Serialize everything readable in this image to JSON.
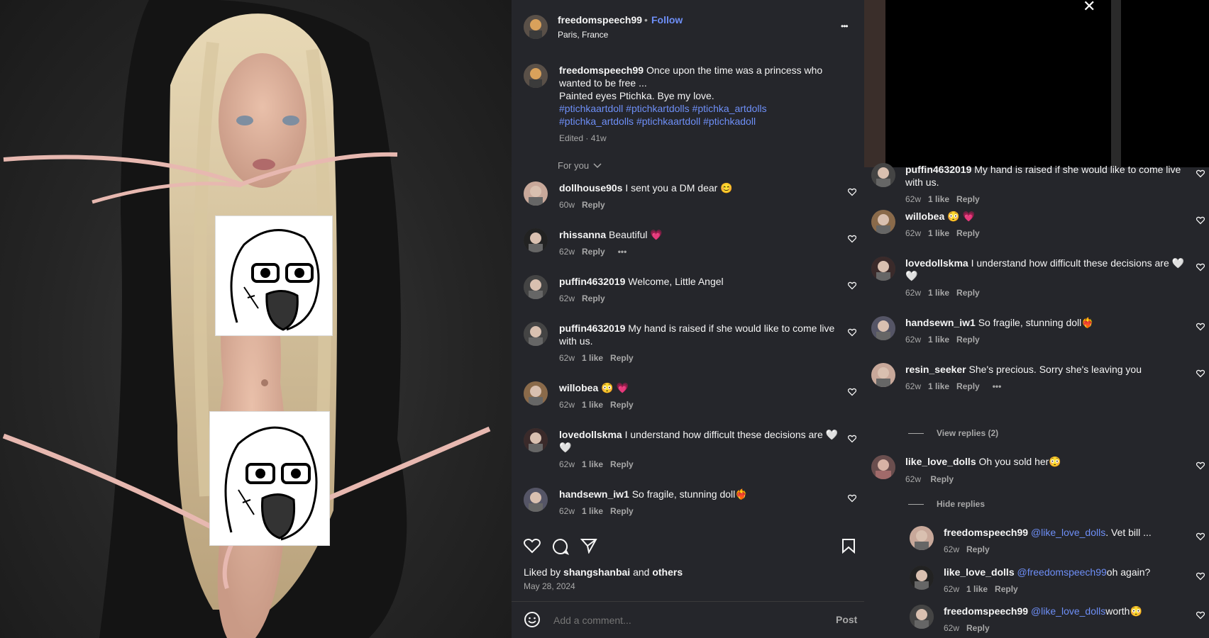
{
  "post": {
    "author": "freedomspeech99",
    "separator": "•",
    "follow_label": "Follow",
    "location": "Paris, France",
    "more_label": "•••",
    "caption_line1": "Once upon the time was a princess who",
    "caption_line2": "wanted to be free ...",
    "caption_line3": "Painted eyes Ptichka. Bye my love.",
    "hashtags_line1": "#ptichkaartdoll #ptichkartdolls #ptichka_artdolls",
    "hashtags_line2": "#ptichka_artdolls #ptichkaartdoll #ptichkadoll",
    "edited_meta": "Edited · 41w",
    "for_you_label": "For you",
    "liked_by_prefix": "Liked by",
    "liked_by_user": "shangshanbai",
    "liked_by_and": "and",
    "liked_by_others": "others",
    "date": "May 28, 2024",
    "add_comment_placeholder": "Add a comment...",
    "post_label": "Post",
    "close_label": "✕"
  },
  "comments_main": [
    {
      "user": "dollhouse90s",
      "text": "I sent you a DM dear 😊",
      "text2": "",
      "time": "60w",
      "likes": "",
      "reply": "Reply",
      "more": ""
    },
    {
      "user": "rhissanna",
      "text": "Beautiful 💗",
      "text2": "",
      "time": "62w",
      "likes": "",
      "reply": "Reply",
      "more": "•••"
    },
    {
      "user": "puffin4632019",
      "text": "Welcome, Little Angel",
      "text2": "",
      "time": "62w",
      "likes": "",
      "reply": "Reply",
      "more": ""
    },
    {
      "user": "puffin4632019",
      "text": "My hand is raised if she would like to come live",
      "text2": "with us.",
      "time": "62w",
      "likes": "1 like",
      "reply": "Reply",
      "more": ""
    },
    {
      "user": "willobea",
      "text": "😳 💗",
      "text2": "",
      "time": "62w",
      "likes": "1 like",
      "reply": "Reply",
      "more": ""
    },
    {
      "user": "lovedollskma",
      "text": "I understand how difficult these decisions are 🤍",
      "text2": "🤍",
      "time": "62w",
      "likes": "1 like",
      "reply": "Reply",
      "more": ""
    },
    {
      "user": "handsewn_iw1",
      "text": "So fragile, stunning doll❤️‍🔥",
      "text2": "",
      "time": "62w",
      "likes": "1 like",
      "reply": "Reply",
      "more": ""
    }
  ],
  "comments_right": [
    {
      "user": "puffin4632019",
      "text": "My hand is raised if she would like to come live",
      "text2": "with us.",
      "time": "62w",
      "likes": "1 like",
      "reply": "Reply",
      "more": ""
    },
    {
      "user": "willobea",
      "text": "😳 💗",
      "text2": "",
      "time": "62w",
      "likes": "1 like",
      "reply": "Reply",
      "more": ""
    },
    {
      "user": "lovedollskma",
      "text": "I understand how difficult these decisions are 🤍",
      "text2": "🤍",
      "time": "62w",
      "likes": "1 like",
      "reply": "Reply",
      "more": ""
    },
    {
      "user": "handsewn_iw1",
      "text": "So fragile, stunning doll❤️‍🔥",
      "text2": "",
      "time": "62w",
      "likes": "1 like",
      "reply": "Reply",
      "more": ""
    },
    {
      "user": "resin_seeker",
      "text": "She's precious. Sorry she's leaving you",
      "text2": "",
      "time": "62w",
      "likes": "1 like",
      "reply": "Reply",
      "more": "•••"
    }
  ],
  "view_replies_label": "View replies (2)",
  "like_love": {
    "user": "like_love_dolls",
    "text": "Oh you sold her😳",
    "time": "62w",
    "reply": "Reply"
  },
  "hide_replies_label": "Hide replies",
  "replies": [
    {
      "user": "freedomspeech99",
      "mention": "@like_love_dolls",
      "text": ". Vet bill ...",
      "time": "62w",
      "likes": "",
      "reply": "Reply"
    },
    {
      "user": "like_love_dolls",
      "mention": "@freedomspeech99",
      "text": "oh again?",
      "time": "62w",
      "likes": "1 like",
      "reply": "Reply"
    },
    {
      "user": "freedomspeech99",
      "mention": "@like_love_dolls",
      "text": "worth😳",
      "time": "62w",
      "likes": "",
      "reply": "Reply"
    }
  ],
  "icons": {
    "heart": "heart-icon",
    "comment": "comment-icon",
    "share": "share-icon",
    "bookmark": "bookmark-icon",
    "emoji": "emoji-icon",
    "close": "close-icon",
    "more": "more-icon",
    "chevron": "chevron-down-icon"
  },
  "colors": {
    "panel": "#25262b",
    "link": "#6e8ff7",
    "muted": "#a8a8a8"
  }
}
